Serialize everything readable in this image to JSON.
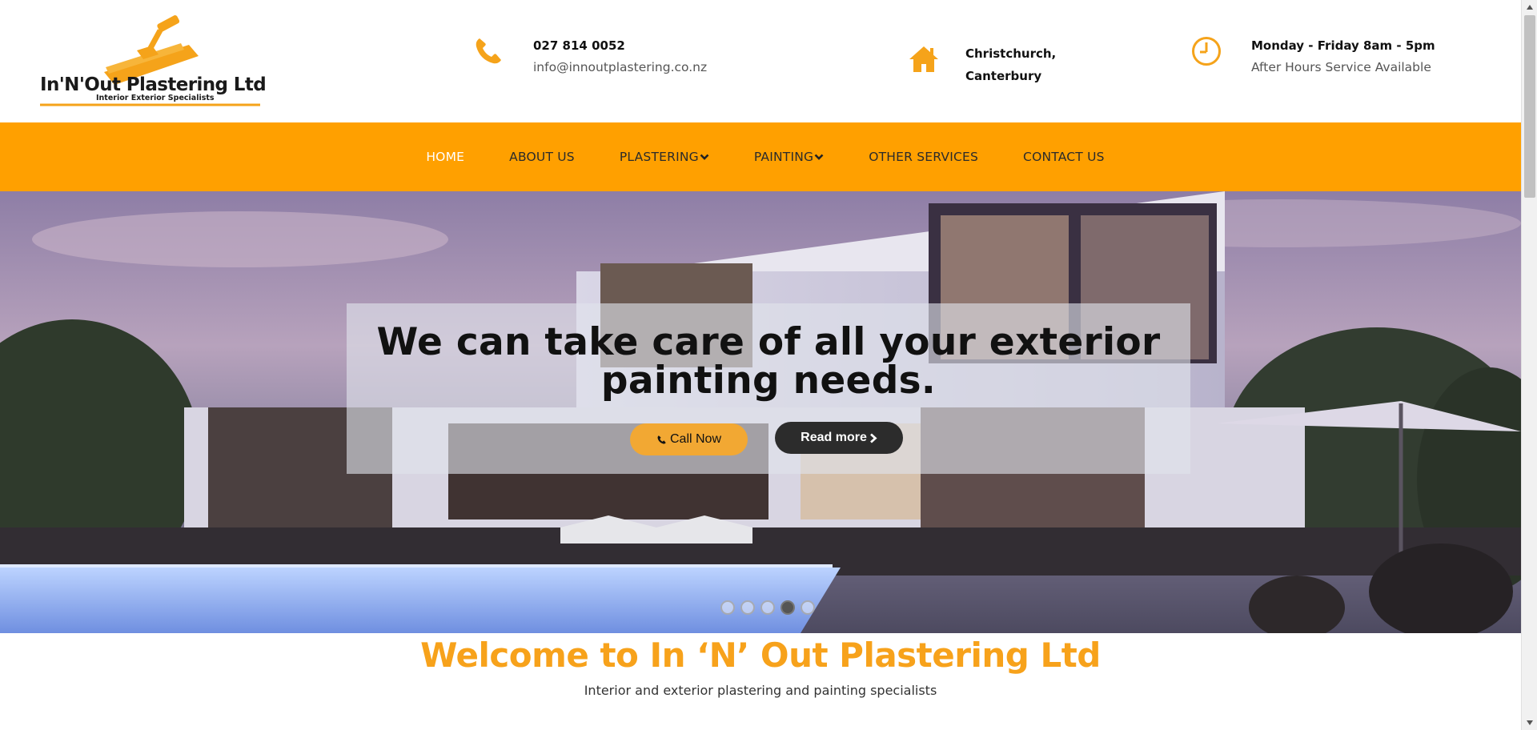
{
  "logo": {
    "name": "In'N'Out Plastering Ltd",
    "tagline": "Interior Exterior Specialists"
  },
  "contact": {
    "phone": "027 814 0052",
    "email": "info@innoutplastering.co.nz"
  },
  "address": {
    "line1": "Christchurch,",
    "line2": "Canterbury"
  },
  "hours": {
    "line1": "Monday - Friday 8am - 5pm",
    "line2": "After Hours Service Available"
  },
  "nav": {
    "items": [
      {
        "label": "HOME",
        "active": true
      },
      {
        "label": "ABOUT US"
      },
      {
        "label": "PLASTERING",
        "dropdown": true
      },
      {
        "label": "PAINTING",
        "dropdown": true
      },
      {
        "label": "OTHER SERVICES"
      },
      {
        "label": "CONTACT US"
      }
    ]
  },
  "hero": {
    "headline_line1": "We can take care of all your exterior",
    "headline_line2": "painting needs.",
    "call_label": "Call Now",
    "read_label": "Read more",
    "slide_count": 5,
    "active_slide": 4
  },
  "welcome": {
    "title": "Welcome to In ‘N’ Out Plastering Ltd",
    "subtitle": "Interior and exterior plastering and painting specialists"
  },
  "colors": {
    "accent": "#ffa000",
    "heading": "#f7a21b"
  },
  "icons": [
    "phone-icon",
    "home-icon",
    "clock-icon",
    "chevron-down-icon",
    "chevron-right-icon"
  ]
}
